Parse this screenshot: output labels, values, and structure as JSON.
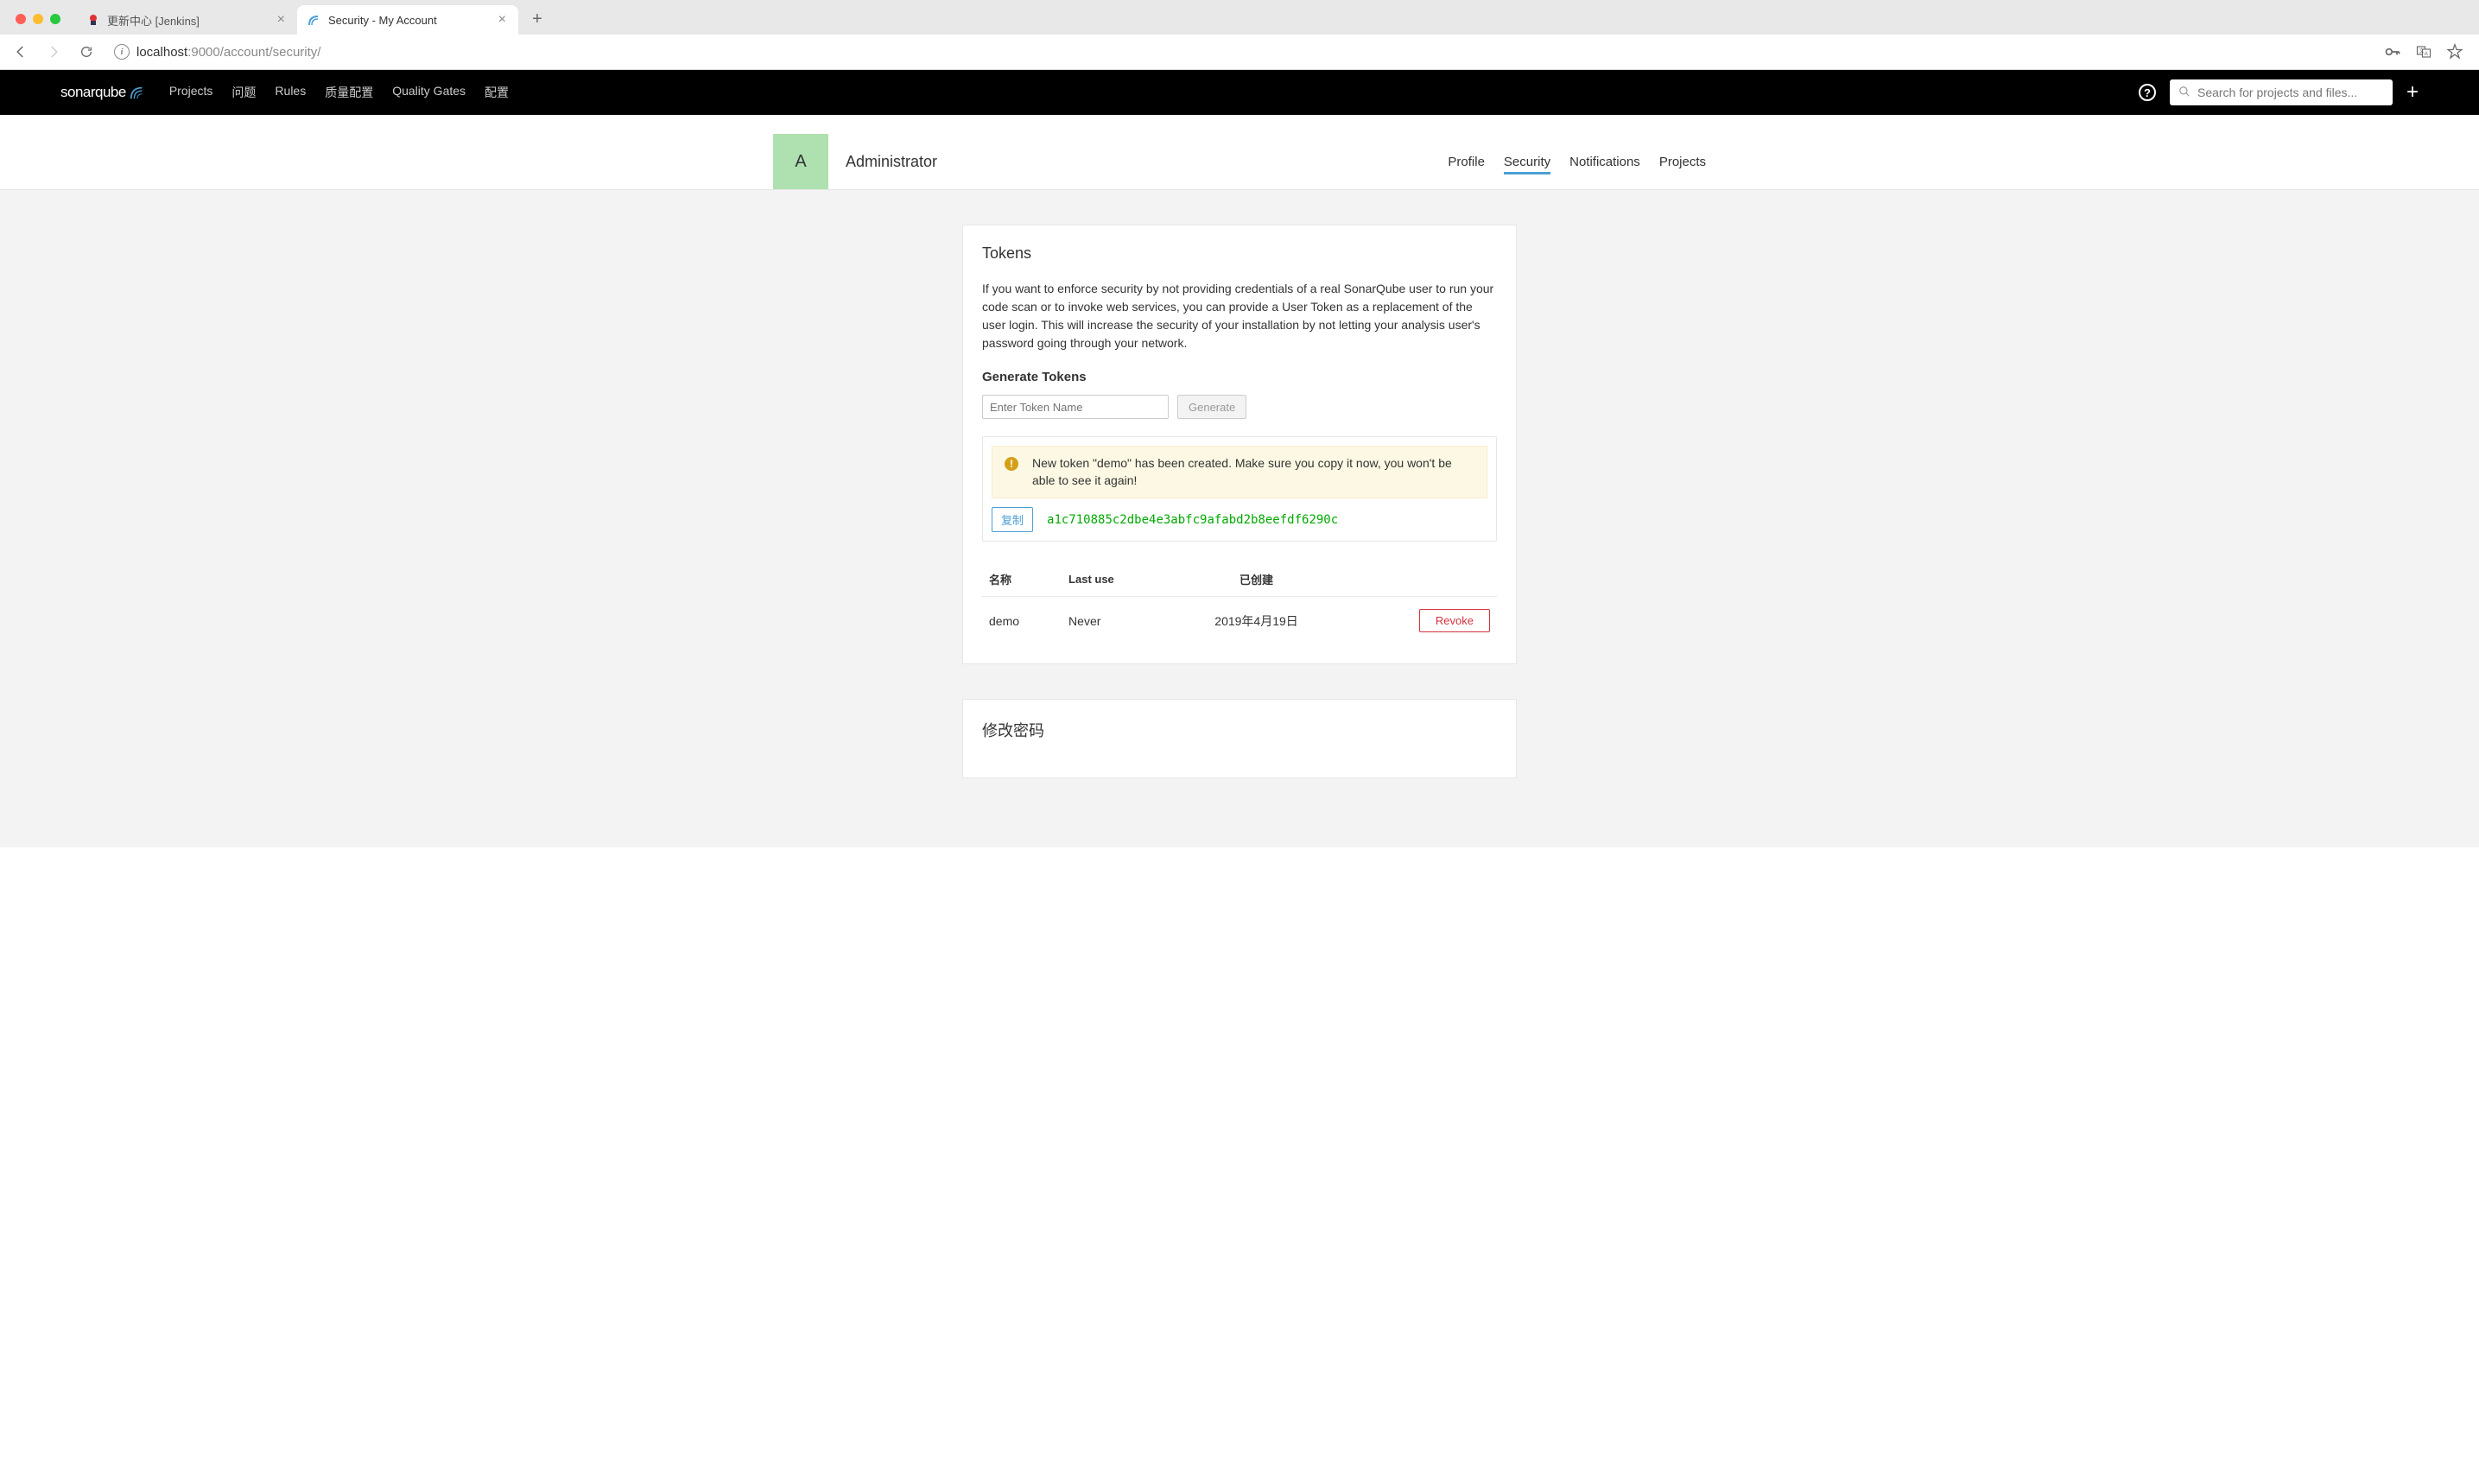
{
  "browser": {
    "tabs": [
      {
        "title": "更新中心 [Jenkins]",
        "active": false
      },
      {
        "title": "Security - My Account",
        "active": true
      }
    ],
    "url_host": "localhost",
    "url_port_path": ":9000/account/security/"
  },
  "header": {
    "logo_text": "sonarqube",
    "nav": [
      "Projects",
      "问题",
      "Rules",
      "质量配置",
      "Quality Gates",
      "配置"
    ],
    "search_placeholder": "Search for projects and files..."
  },
  "account": {
    "avatar_letter": "A",
    "name": "Administrator",
    "tabs": [
      "Profile",
      "Security",
      "Notifications",
      "Projects"
    ],
    "active_tab": "Security"
  },
  "tokens_card": {
    "title": "Tokens",
    "description": "If you want to enforce security by not providing credentials of a real SonarQube user to run your code scan or to invoke web services, you can provide a User Token as a replacement of the user login. This will increase the security of your installation by not letting your analysis user's password going through your network.",
    "generate_title": "Generate Tokens",
    "input_placeholder": "Enter Token Name",
    "generate_button": "Generate",
    "alert_message": "New token \"demo\" has been created. Make sure you copy it now, you won't be able to see it again!",
    "copy_button": "复制",
    "token_value": "a1c710885c2dbe4e3abfc9afabd2b8eefdf6290c",
    "table_headers": {
      "name": "名称",
      "last_use": "Last use",
      "created": "已创建"
    },
    "rows": [
      {
        "name": "demo",
        "last_use": "Never",
        "created": "2019年4月19日",
        "revoke": "Revoke"
      }
    ]
  },
  "password_card": {
    "title": "修改密码"
  }
}
